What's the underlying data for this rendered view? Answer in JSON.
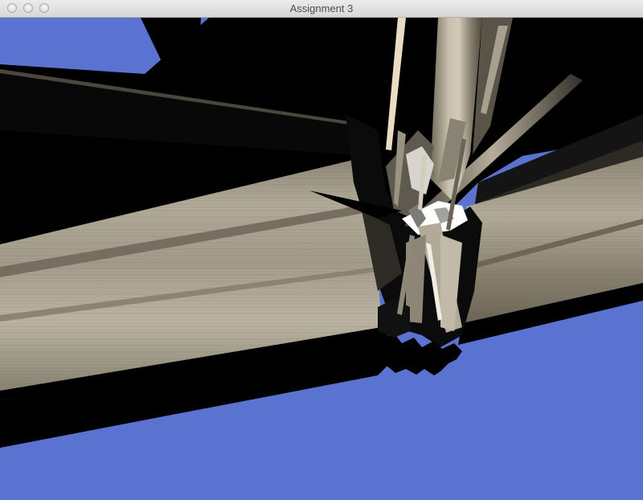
{
  "window": {
    "title": "Assignment 3"
  },
  "colors": {
    "background": "#5a72d0",
    "beam": "#b8b1a0",
    "shadow": "#000000",
    "highlight": "#ffffff"
  }
}
